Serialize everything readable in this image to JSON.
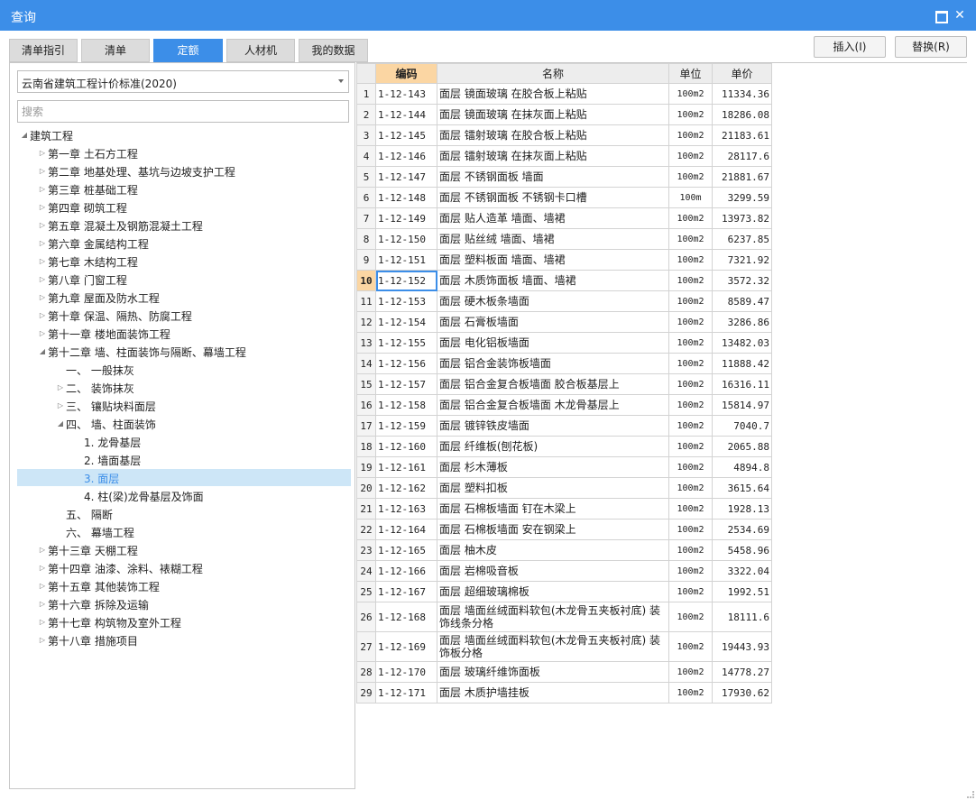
{
  "window": {
    "title": "查询"
  },
  "tabs": [
    "清单指引",
    "清单",
    "定额",
    "人材机",
    "我的数据"
  ],
  "buttons": {
    "insert": "插入(I)",
    "replace": "替换(R)"
  },
  "left": {
    "standard": "云南省建筑工程计价标准(2020)",
    "search_placeholder": "搜索",
    "tree": [
      {
        "label": "建筑工程",
        "level": 0,
        "toggle": "expanded"
      },
      {
        "label": "第一章 土石方工程",
        "level": 1,
        "toggle": "collapsed"
      },
      {
        "label": "第二章 地基处理、基坑与边坡支护工程",
        "level": 1,
        "toggle": "collapsed"
      },
      {
        "label": "第三章 桩基础工程",
        "level": 1,
        "toggle": "collapsed"
      },
      {
        "label": "第四章 砌筑工程",
        "level": 1,
        "toggle": "collapsed"
      },
      {
        "label": "第五章 混凝土及钢筋混凝土工程",
        "level": 1,
        "toggle": "collapsed"
      },
      {
        "label": "第六章 金属结构工程",
        "level": 1,
        "toggle": "collapsed"
      },
      {
        "label": "第七章 木结构工程",
        "level": 1,
        "toggle": "collapsed"
      },
      {
        "label": "第八章 门窗工程",
        "level": 1,
        "toggle": "collapsed"
      },
      {
        "label": "第九章 屋面及防水工程",
        "level": 1,
        "toggle": "collapsed"
      },
      {
        "label": "第十章 保温、隔热、防腐工程",
        "level": 1,
        "toggle": "collapsed"
      },
      {
        "label": "第十一章 楼地面装饰工程",
        "level": 1,
        "toggle": "collapsed"
      },
      {
        "label": "第十二章 墙、柱面装饰与隔断、幕墙工程",
        "level": 1,
        "toggle": "expanded"
      },
      {
        "label": "一、 一般抹灰",
        "level": 2,
        "toggle": "none"
      },
      {
        "label": "二、 装饰抹灰",
        "level": 2,
        "toggle": "collapsed"
      },
      {
        "label": "三、 镶贴块料面层",
        "level": 2,
        "toggle": "collapsed"
      },
      {
        "label": "四、 墙、柱面装饰",
        "level": 2,
        "toggle": "expanded"
      },
      {
        "label": "1. 龙骨基层",
        "level": 3,
        "toggle": "none"
      },
      {
        "label": "2. 墙面基层",
        "level": 3,
        "toggle": "none"
      },
      {
        "label": "3. 面层",
        "level": 3,
        "toggle": "none",
        "selected": true
      },
      {
        "label": "4. 柱(梁)龙骨基层及饰面",
        "level": 3,
        "toggle": "none"
      },
      {
        "label": "五、 隔断",
        "level": 2,
        "toggle": "none"
      },
      {
        "label": "六、 幕墙工程",
        "level": 2,
        "toggle": "none"
      },
      {
        "label": "第十三章 天棚工程",
        "level": 1,
        "toggle": "collapsed"
      },
      {
        "label": "第十四章 油漆、涂料、裱糊工程",
        "level": 1,
        "toggle": "collapsed"
      },
      {
        "label": "第十五章 其他装饰工程",
        "level": 1,
        "toggle": "collapsed"
      },
      {
        "label": "第十六章 拆除及运输",
        "level": 1,
        "toggle": "collapsed"
      },
      {
        "label": "第十七章 构筑物及室外工程",
        "level": 1,
        "toggle": "collapsed"
      },
      {
        "label": "第十八章 措施项目",
        "level": 1,
        "toggle": "collapsed"
      }
    ]
  },
  "grid": {
    "headers": {
      "code": "编码",
      "name": "名称",
      "unit": "单位",
      "price": "单价"
    },
    "current_row": 10,
    "rows": [
      {
        "n": "1",
        "code": "1-12-143",
        "name": "面层 镜面玻璃 在胶合板上粘贴",
        "unit": "100m2",
        "price": "11334.36"
      },
      {
        "n": "2",
        "code": "1-12-144",
        "name": "面层 镜面玻璃 在抹灰面上粘贴",
        "unit": "100m2",
        "price": "18286.08"
      },
      {
        "n": "3",
        "code": "1-12-145",
        "name": "面层 镭射玻璃 在胶合板上粘贴",
        "unit": "100m2",
        "price": "21183.61"
      },
      {
        "n": "4",
        "code": "1-12-146",
        "name": "面层 镭射玻璃 在抹灰面上粘贴",
        "unit": "100m2",
        "price": "28117.6"
      },
      {
        "n": "5",
        "code": "1-12-147",
        "name": "面层 不锈钢面板 墙面",
        "unit": "100m2",
        "price": "21881.67"
      },
      {
        "n": "6",
        "code": "1-12-148",
        "name": "面层 不锈钢面板 不锈钢卡口槽",
        "unit": "100m",
        "price": "3299.59"
      },
      {
        "n": "7",
        "code": "1-12-149",
        "name": "面层 贴人造革 墙面、墙裙",
        "unit": "100m2",
        "price": "13973.82"
      },
      {
        "n": "8",
        "code": "1-12-150",
        "name": "面层 贴丝绒 墙面、墙裙",
        "unit": "100m2",
        "price": "6237.85"
      },
      {
        "n": "9",
        "code": "1-12-151",
        "name": "面层 塑料板面 墙面、墙裙",
        "unit": "100m2",
        "price": "7321.92"
      },
      {
        "n": "10",
        "code": "1-12-152",
        "name": "面层 木质饰面板 墙面、墙裙",
        "unit": "100m2",
        "price": "3572.32"
      },
      {
        "n": "11",
        "code": "1-12-153",
        "name": "面层 硬木板条墙面",
        "unit": "100m2",
        "price": "8589.47"
      },
      {
        "n": "12",
        "code": "1-12-154",
        "name": "面层 石膏板墙面",
        "unit": "100m2",
        "price": "3286.86"
      },
      {
        "n": "13",
        "code": "1-12-155",
        "name": "面层 电化铝板墙面",
        "unit": "100m2",
        "price": "13482.03"
      },
      {
        "n": "14",
        "code": "1-12-156",
        "name": "面层 铝合金装饰板墙面",
        "unit": "100m2",
        "price": "11888.42"
      },
      {
        "n": "15",
        "code": "1-12-157",
        "name": "面层 铝合金复合板墙面 胶合板基层上",
        "unit": "100m2",
        "price": "16316.11"
      },
      {
        "n": "16",
        "code": "1-12-158",
        "name": "面层 铝合金复合板墙面 木龙骨基层上",
        "unit": "100m2",
        "price": "15814.97"
      },
      {
        "n": "17",
        "code": "1-12-159",
        "name": "面层 镀锌铁皮墙面",
        "unit": "100m2",
        "price": "7040.7"
      },
      {
        "n": "18",
        "code": "1-12-160",
        "name": "面层 纤维板(刨花板)",
        "unit": "100m2",
        "price": "2065.88"
      },
      {
        "n": "19",
        "code": "1-12-161",
        "name": "面层 杉木薄板",
        "unit": "100m2",
        "price": "4894.8"
      },
      {
        "n": "20",
        "code": "1-12-162",
        "name": "面层 塑料扣板",
        "unit": "100m2",
        "price": "3615.64"
      },
      {
        "n": "21",
        "code": "1-12-163",
        "name": "面层 石棉板墙面 钉在木梁上",
        "unit": "100m2",
        "price": "1928.13"
      },
      {
        "n": "22",
        "code": "1-12-164",
        "name": "面层 石棉板墙面 安在钢梁上",
        "unit": "100m2",
        "price": "2534.69"
      },
      {
        "n": "23",
        "code": "1-12-165",
        "name": "面层 柚木皮",
        "unit": "100m2",
        "price": "5458.96"
      },
      {
        "n": "24",
        "code": "1-12-166",
        "name": "面层 岩棉吸音板",
        "unit": "100m2",
        "price": "3322.04"
      },
      {
        "n": "25",
        "code": "1-12-167",
        "name": "面层 超细玻璃棉板",
        "unit": "100m2",
        "price": "1992.51"
      },
      {
        "n": "26",
        "code": "1-12-168",
        "name": "面层 墙面丝绒面料软包(木龙骨五夹板衬底) 装饰线条分格",
        "unit": "100m2",
        "price": "18111.6"
      },
      {
        "n": "27",
        "code": "1-12-169",
        "name": "面层 墙面丝绒面料软包(木龙骨五夹板衬底) 装饰板分格",
        "unit": "100m2",
        "price": "19443.93"
      },
      {
        "n": "28",
        "code": "1-12-170",
        "name": "面层 玻璃纤维饰面板",
        "unit": "100m2",
        "price": "14778.27"
      },
      {
        "n": "29",
        "code": "1-12-171",
        "name": "面层 木质护墙挂板",
        "unit": "100m2",
        "price": "17930.62"
      }
    ]
  },
  "colors": {
    "accent": "#3c8ee8",
    "header_highlight": "#fbd6a3",
    "selection": "#cde6f7"
  }
}
